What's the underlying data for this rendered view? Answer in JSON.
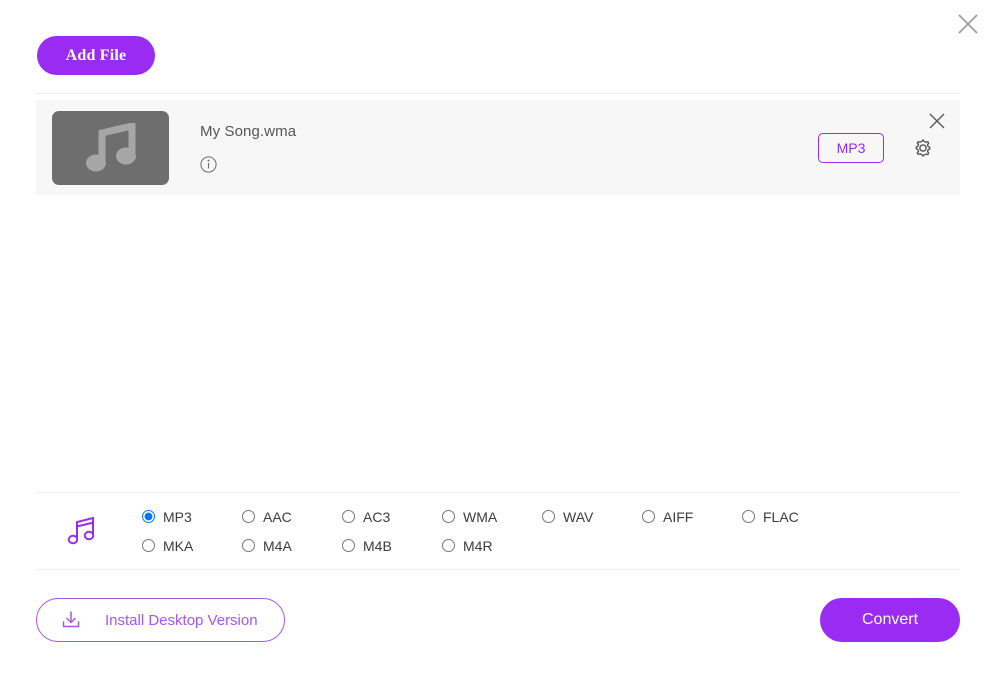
{
  "window": {
    "close_icon": "close-icon"
  },
  "toolbar": {
    "add_file_label": "Add File"
  },
  "file_list": {
    "rows": [
      {
        "name": "My Song.wma",
        "thumb_icon": "music-note-icon",
        "info_icon": "info-icon",
        "target_format": "MP3",
        "settings_icon": "gear-icon",
        "remove_icon": "close-icon"
      }
    ]
  },
  "format_section": {
    "type_icon": "music-note-icon",
    "selected": "MP3",
    "options": [
      "MP3",
      "AAC",
      "AC3",
      "WMA",
      "WAV",
      "AIFF",
      "FLAC",
      "MKA",
      "M4A",
      "M4B",
      "M4R"
    ]
  },
  "footer": {
    "install_label": "Install Desktop Version",
    "install_icon": "download-icon",
    "convert_label": "Convert"
  },
  "colors": {
    "accent": "#9a2bf2",
    "accent_light": "#a855f7",
    "row_background": "#f7f7f7",
    "thumb_background": "#6e6e6e",
    "radio_checked": "#1a73e8"
  }
}
